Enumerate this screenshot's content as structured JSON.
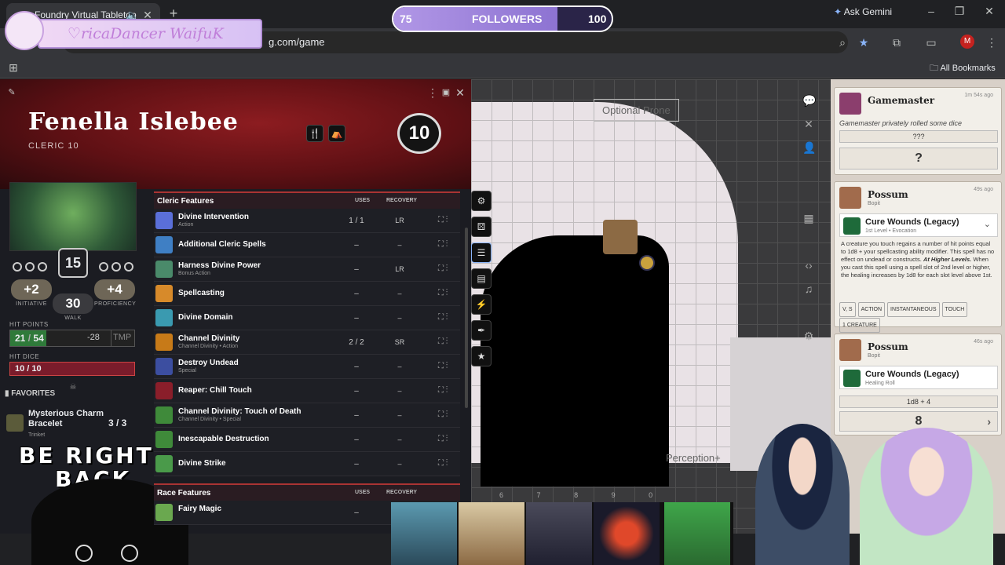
{
  "browser": {
    "tab_title": "Foundry Virtual Tabletop",
    "url": "g.com/game",
    "gemini_label": "Ask Gemini",
    "bookmarks_label": "All Bookmarks",
    "profile_initial": "M"
  },
  "overlay": {
    "banner_text": "♡ricaDancer  WaifuK",
    "followers_label": "FOLLOWERS",
    "followers_current": "75",
    "followers_goal": "100",
    "followers_progress": 0.75,
    "brb_line1": "BE RIGHT",
    "brb_line2": "BACK"
  },
  "character": {
    "name": "Fenella Islebee",
    "class": "CLERIC 10",
    "level": "10",
    "ac": "15",
    "initiative": "+2",
    "initiative_label": "INITIATIVE",
    "speed": "30",
    "speed_label": "WALK",
    "proficiency": "+4",
    "proficiency_label": "PROFICIENCY",
    "hp_label": "HIT POINTS",
    "hp_current": "21",
    "hp_max": "54",
    "hp_delta": "-28",
    "hp_temp": "TMP",
    "hit_dice_label": "HIT DICE",
    "hit_dice": "10 / 10",
    "favorites_label": "FAVORITES",
    "favorite_item": {
      "name": "Mysterious Charm Bracelet",
      "type": "Trinket",
      "uses": "3 / 3"
    }
  },
  "features": {
    "header": "Cleric Features",
    "col_uses": "USES",
    "col_recovery": "RECOVERY",
    "rows": [
      {
        "name": "Divine Intervention",
        "sub": "Action",
        "uses": "1 / 1",
        "recovery": "LR",
        "color": "#5a6fd8"
      },
      {
        "name": "Additional Cleric Spells",
        "sub": "",
        "uses": "–",
        "recovery": "–",
        "color": "#3f7fc4"
      },
      {
        "name": "Harness Divine Power",
        "sub": "Bonus Action",
        "uses": "–",
        "recovery": "LR",
        "color": "#4a8a6a"
      },
      {
        "name": "Spellcasting",
        "sub": "",
        "uses": "–",
        "recovery": "–",
        "color": "#d78a2a"
      },
      {
        "name": "Divine Domain",
        "sub": "",
        "uses": "–",
        "recovery": "–",
        "color": "#3a9ab0"
      },
      {
        "name": "Channel Divinity",
        "sub": "Channel Divinity • Action",
        "uses": "2 / 2",
        "recovery": "SR",
        "color": "#c77a18"
      },
      {
        "name": "Destroy Undead",
        "sub": "Special",
        "uses": "–",
        "recovery": "–",
        "color": "#3c4ea0"
      },
      {
        "name": "Reaper: Chill Touch",
        "sub": "",
        "uses": "–",
        "recovery": "–",
        "color": "#8a1e2a"
      },
      {
        "name": "Channel Divinity: Touch of Death",
        "sub": "Channel Divinity • Special",
        "uses": "–",
        "recovery": "–",
        "color": "#3f8a3a"
      },
      {
        "name": "Inescapable Destruction",
        "sub": "",
        "uses": "–",
        "recovery": "–",
        "color": "#3f8a3a"
      },
      {
        "name": "Divine Strike",
        "sub": "",
        "uses": "–",
        "recovery": "–",
        "color": "#4a9a4a"
      }
    ],
    "race_header": "Race Features",
    "race_rows": [
      {
        "name": "Fairy Magic",
        "uses": "–",
        "color": "#6aa84f"
      }
    ]
  },
  "map": {
    "note1": "Optional Prone",
    "note2": "Perception+",
    "grid_numbers": [
      "6",
      "7",
      "8",
      "9",
      "0"
    ]
  },
  "chat": {
    "messages": [
      {
        "author": "Gamemaster",
        "time": "1m 54s ago",
        "text": "Gamemaster privately rolled some dice",
        "formula": "???",
        "result": "?"
      },
      {
        "author": "Possum",
        "sub": "Bopit",
        "time": "49s ago",
        "spell": "Cure Wounds (Legacy)",
        "spell_sub": "1st Level • Evocation",
        "desc": "A creature you touch regains a number of hit points equal to 1d8 + your spellcasting ability modifier. This spell has no effect on undead or constructs.",
        "higher_label": "At Higher Levels.",
        "higher": "When you cast this spell using a spell slot of 2nd level or higher, the healing increases by 1d8 for each slot level above 1st.",
        "tags": [
          "V, S",
          "ACTION",
          "INSTANTANEOUS",
          "TOUCH",
          "1 CREATURE"
        ]
      },
      {
        "author": "Possum",
        "sub": "Bopit",
        "time": "46s ago",
        "spell": "Cure Wounds (Legacy)",
        "spell_sub": "Healing Roll",
        "formula": "1d8 + 4",
        "result": "8"
      }
    ]
  }
}
